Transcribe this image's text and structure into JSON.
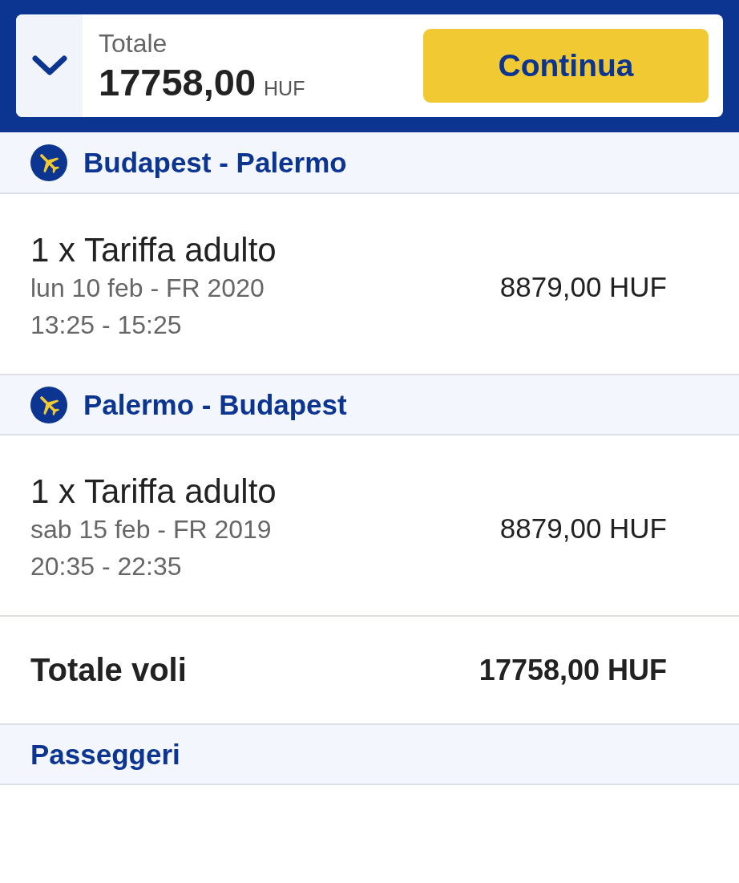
{
  "summary_bar": {
    "label": "Totale",
    "amount": "17758,00",
    "currency": "HUF",
    "button": "Continua"
  },
  "flights": [
    {
      "route": "Budapest - Palermo",
      "fares": [
        {
          "description": "1 x Tariffa adulto",
          "date": "lun 10 feb - FR 2020",
          "time": "13:25 - 15:25",
          "price": "8879,00 HUF"
        }
      ]
    },
    {
      "route": "Palermo - Budapest",
      "fares": [
        {
          "description": "1 x Tariffa adulto",
          "date": "sab 15 feb - FR 2019",
          "time": "20:35 - 22:35",
          "price": "8879,00 HUF"
        }
      ]
    }
  ],
  "total": {
    "label": "Totale voli",
    "amount": "17758,00 HUF"
  },
  "sections": [
    {
      "title": "Passeggeri"
    }
  ]
}
